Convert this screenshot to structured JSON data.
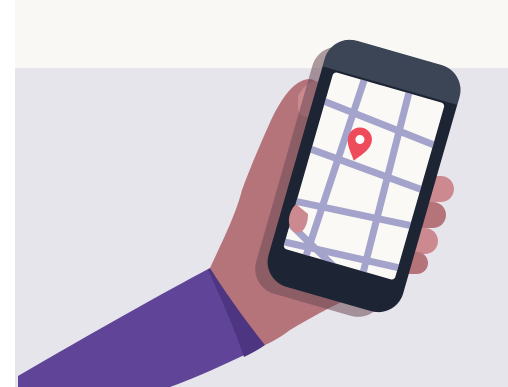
{
  "illustration": {
    "subject": "hand-holding-phone-with-map",
    "colors": {
      "top_band": "#faf8f5",
      "background": "#e7e5ec",
      "border": "#ffffff",
      "sleeve": "#5f4497",
      "sleeve_shadow": "#4d3581",
      "skin": "#b5737a",
      "skin_light": "#cc8a90",
      "skin_dark": "#8d5258",
      "phone_body": "#1d2434",
      "phone_top": "#3b4556",
      "phone_shadow": "#6b4a55",
      "screen": "#fbf9f6",
      "map_road": "#a3a3cc",
      "pin": "#ee4c5a",
      "pin_center": "#ffffff"
    },
    "icons": [
      "map-pin-icon"
    ]
  }
}
